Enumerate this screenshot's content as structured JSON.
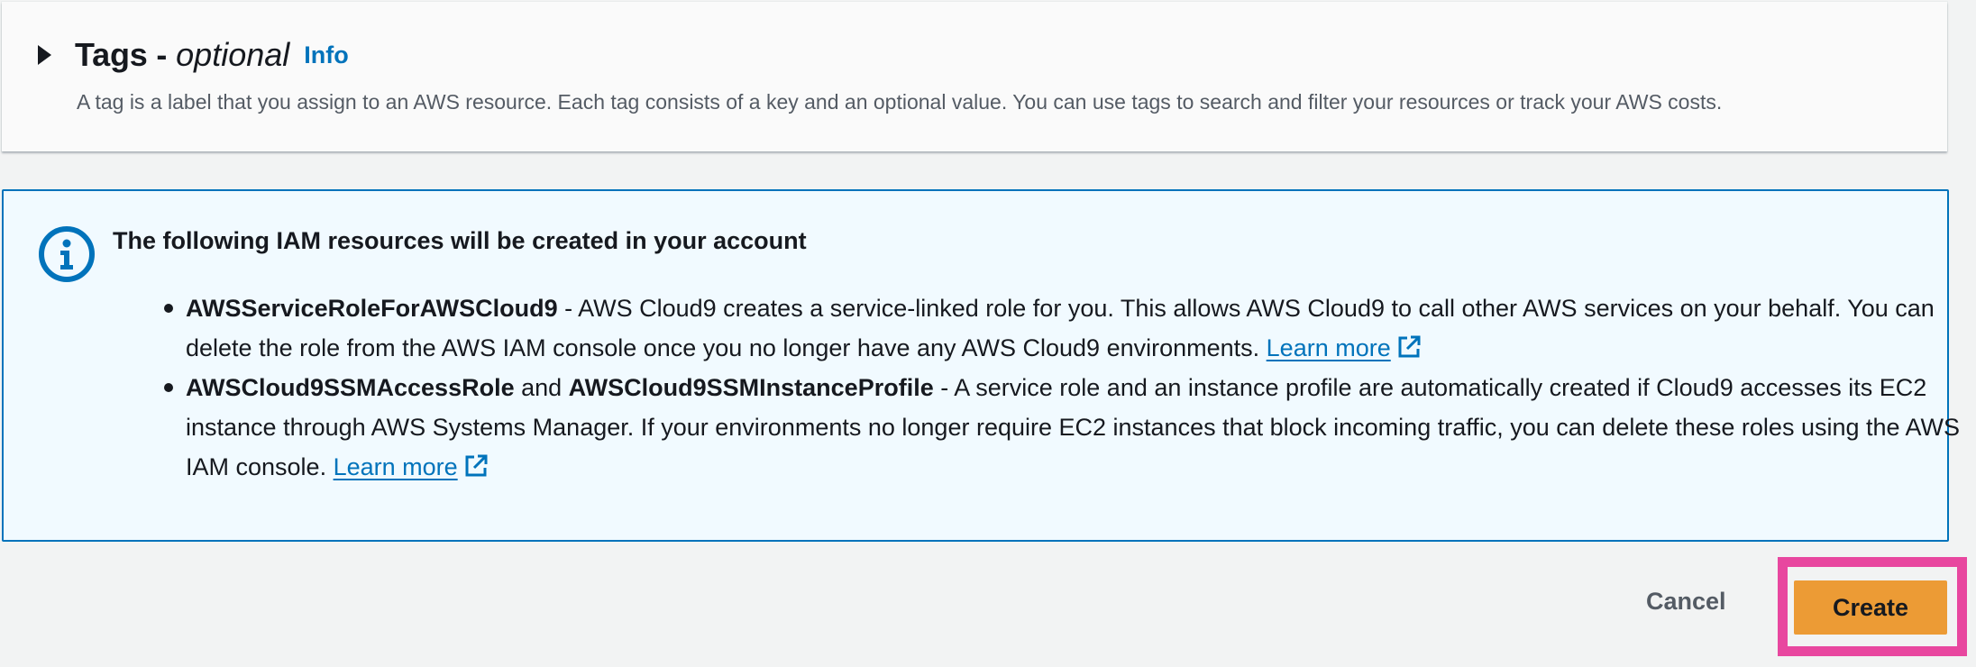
{
  "tags_section": {
    "title": "Tags -",
    "title_optional": "optional",
    "info_link": "Info",
    "description": "A tag is a label that you assign to an AWS resource. Each tag consists of a key and an optional value. You can use tags to search and filter your resources or track your AWS costs.",
    "expanded": false
  },
  "iam_alert": {
    "icon": "info-icon",
    "title": "The following IAM resources will be created in your account",
    "items": [
      {
        "role_name": "AWSServiceRoleForAWSCloud9",
        "text": " - AWS Cloud9 creates a service-linked role for you. This allows AWS Cloud9 to call other AWS services on your behalf. You can delete the role from the AWS IAM console once you no longer have any AWS Cloud9 environments. ",
        "link": "Learn more"
      },
      {
        "role_name": "AWSCloud9SSMAccessRole",
        "conjunction": " and ",
        "profile_name": "AWSCloud9SSMInstanceProfile",
        "text": " - A service role and an instance profile are automatically created if Cloud9 accesses its EC2 instance through AWS Systems Manager. If your environments no longer require EC2 instances that block incoming traffic, you can delete these roles using the AWS IAM console. ",
        "link": "Learn more"
      }
    ]
  },
  "footer": {
    "cancel_label": "Cancel",
    "create_label": "Create"
  },
  "colors": {
    "link": "#0073bb",
    "primary_button": "#ec9b35",
    "alert_background": "#f1faff",
    "alert_border": "#0073bb",
    "highlight": "#e8479f"
  }
}
